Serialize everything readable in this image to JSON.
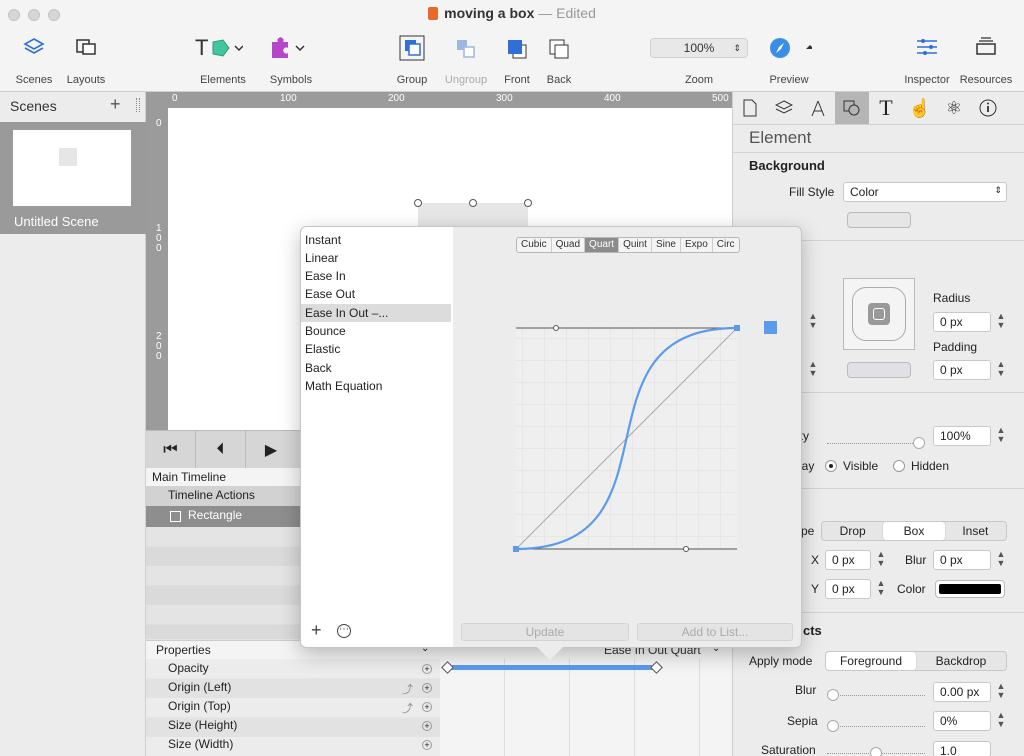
{
  "window": {
    "title": "moving a box",
    "status": "— Edited"
  },
  "toolbar": {
    "scenes": "Scenes",
    "layouts": "Layouts",
    "elements": "Elements",
    "symbols": "Symbols",
    "group": "Group",
    "ungroup": "Ungroup",
    "front": "Front",
    "back": "Back",
    "zoom_label": "Zoom",
    "zoom_value": "100%",
    "preview": "Preview",
    "inspector": "Inspector",
    "resources": "Resources",
    "elements_icon_text": "T"
  },
  "scenes_panel": {
    "title": "Scenes",
    "add": "+",
    "scene_name": "Untitled Scene"
  },
  "ruler": {
    "top": [
      "0",
      "100",
      "200",
      "300",
      "400",
      "500"
    ],
    "left": [
      "0",
      "1\n0\n0",
      "2\n0\n0"
    ]
  },
  "timeline": {
    "main": "Main Timeline",
    "actions": "Timeline Actions",
    "rectangle": "Rectangle",
    "properties": "Properties",
    "props": [
      "Opacity",
      "Origin (Left)",
      "Origin (Top)",
      "Size (Height)",
      "Size (Width)"
    ],
    "easing_label": "Ease In Out Quart"
  },
  "easing": {
    "items": [
      "Instant",
      "Linear",
      "Ease In",
      "Ease Out",
      "Ease In Out –...",
      "Bounce",
      "Elastic",
      "Back",
      "Math Equation"
    ],
    "selected_index": 4,
    "tabs": [
      "Cubic",
      "Quad",
      "Quart",
      "Quint",
      "Sine",
      "Expo",
      "Circ"
    ],
    "selected_tab": "Quart",
    "update": "Update",
    "add_to_list": "Add to List...",
    "add": "+",
    "more": "⋯"
  },
  "inspector": {
    "heading": "Element",
    "background": "Background",
    "fill_style_label": "Fill Style",
    "fill_style_value": "Color",
    "radius_label": "Radius",
    "radius_value": "0 px",
    "padding_label": "Padding",
    "padding_value": "0 px",
    "opacity_label": "city",
    "opacity_value": "100%",
    "opacity_level": 1.0,
    "display_label": "lay",
    "visible": "Visible",
    "hidden": "Hidden",
    "shadow_type_label": "pe",
    "shadow_types": [
      "Drop",
      "Box",
      "Inset"
    ],
    "shadow_selected": "Box",
    "x_label": "X",
    "x_value": "0 px",
    "y_label": "Y",
    "y_value": "0 px",
    "blur_label": "Blur",
    "blur_value": "0 px",
    "color_label": "Color",
    "effects_label": "cts",
    "apply_mode_label": "Apply mode",
    "apply_modes": [
      "Foreground",
      "Backdrop"
    ],
    "apply_selected": "Foreground",
    "fx_blur_label": "Blur",
    "fx_blur_value": "0.00 px",
    "fx_blur_level": 0.0,
    "sepia_label": "Sepia",
    "sepia_value": "0%",
    "sepia_level": 0.0,
    "saturation_label": "Saturation",
    "saturation_value": "1.0",
    "saturation_level": 0.5
  },
  "colors": {
    "accent": "#5b9bea",
    "selection": "#9a9a9a",
    "shadow_color": "#000000"
  }
}
